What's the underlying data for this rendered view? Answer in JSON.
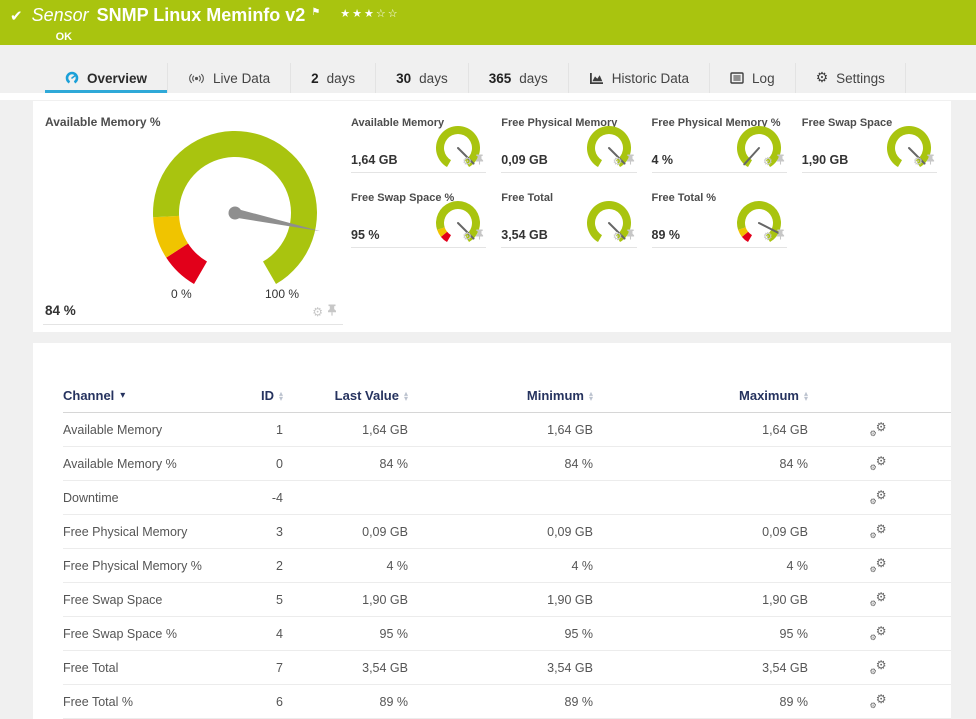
{
  "colors": {
    "green": "#a9c40f",
    "yellow": "#f0c400",
    "red": "#e2001a",
    "accent_blue": "#2fa9d8",
    "header_navy": "#26335f"
  },
  "header": {
    "status_icon": "✔",
    "kind_label": "Sensor",
    "title": "SNMP Linux Meminfo v2",
    "flag_icon": "⚑",
    "stars": "★★★☆☆",
    "status": "OK"
  },
  "tabs": [
    {
      "label": "Overview",
      "active": true
    },
    {
      "label": "Live Data"
    },
    {
      "prefix": "2",
      "label": "days"
    },
    {
      "prefix": "30",
      "label": "days"
    },
    {
      "prefix": "365",
      "label": "days"
    },
    {
      "label": "Historic Data"
    },
    {
      "label": "Log"
    },
    {
      "label": "Settings"
    }
  ],
  "gauges": {
    "primary": {
      "title": "Available Memory %",
      "value": "84 %",
      "percent": 84,
      "min_label": "0 %",
      "max_label": "100 %",
      "segments": [
        [
          0,
          9,
          "red"
        ],
        [
          9,
          19,
          "yellow"
        ],
        [
          19,
          100,
          "green"
        ]
      ]
    },
    "small": [
      {
        "title": "Available Memory",
        "value": "1,64 GB",
        "percent": 95,
        "segments": [
          [
            0,
            100,
            "green"
          ]
        ]
      },
      {
        "title": "Free Physical Memory",
        "value": "0,09 GB",
        "percent": 95,
        "segments": [
          [
            0,
            100,
            "green"
          ]
        ]
      },
      {
        "title": "Free Physical Memory %",
        "value": "4 %",
        "percent": 4,
        "segments": [
          [
            0,
            100,
            "green"
          ]
        ]
      },
      {
        "title": "Free Swap Space",
        "value": "1,90 GB",
        "percent": 95,
        "segments": [
          [
            0,
            100,
            "green"
          ]
        ]
      },
      {
        "title": "Free Swap Space %",
        "value": "95 %",
        "percent": 95,
        "segments": [
          [
            0,
            7,
            "red"
          ],
          [
            7,
            14,
            "yellow"
          ],
          [
            14,
            100,
            "green"
          ]
        ]
      },
      {
        "title": "Free Total",
        "value": "3,54 GB",
        "percent": 95,
        "segments": [
          [
            0,
            100,
            "green"
          ]
        ]
      },
      {
        "title": "Free Total %",
        "value": "89 %",
        "percent": 89,
        "segments": [
          [
            0,
            7,
            "red"
          ],
          [
            7,
            14,
            "yellow"
          ],
          [
            14,
            100,
            "green"
          ]
        ]
      }
    ]
  },
  "table": {
    "columns": [
      "Channel",
      "ID",
      "Last Value",
      "Minimum",
      "Maximum"
    ],
    "rows": [
      {
        "channel": "Available Memory",
        "id": "1",
        "last": "1,64 GB",
        "min": "1,64 GB",
        "max": "1,64 GB"
      },
      {
        "channel": "Available Memory %",
        "id": "0",
        "last": "84 %",
        "min": "84 %",
        "max": "84 %"
      },
      {
        "channel": "Downtime",
        "id": "-4",
        "last": "",
        "min": "",
        "max": ""
      },
      {
        "channel": "Free Physical Memory",
        "id": "3",
        "last": "0,09 GB",
        "min": "0,09 GB",
        "max": "0,09 GB"
      },
      {
        "channel": "Free Physical Memory %",
        "id": "2",
        "last": "4 %",
        "min": "4 %",
        "max": "4 %"
      },
      {
        "channel": "Free Swap Space",
        "id": "5",
        "last": "1,90 GB",
        "min": "1,90 GB",
        "max": "1,90 GB"
      },
      {
        "channel": "Free Swap Space %",
        "id": "4",
        "last": "95 %",
        "min": "95 %",
        "max": "95 %"
      },
      {
        "channel": "Free Total",
        "id": "7",
        "last": "3,54 GB",
        "min": "3,54 GB",
        "max": "3,54 GB"
      },
      {
        "channel": "Free Total %",
        "id": "6",
        "last": "89 %",
        "min": "89 %",
        "max": "89 %"
      }
    ]
  }
}
